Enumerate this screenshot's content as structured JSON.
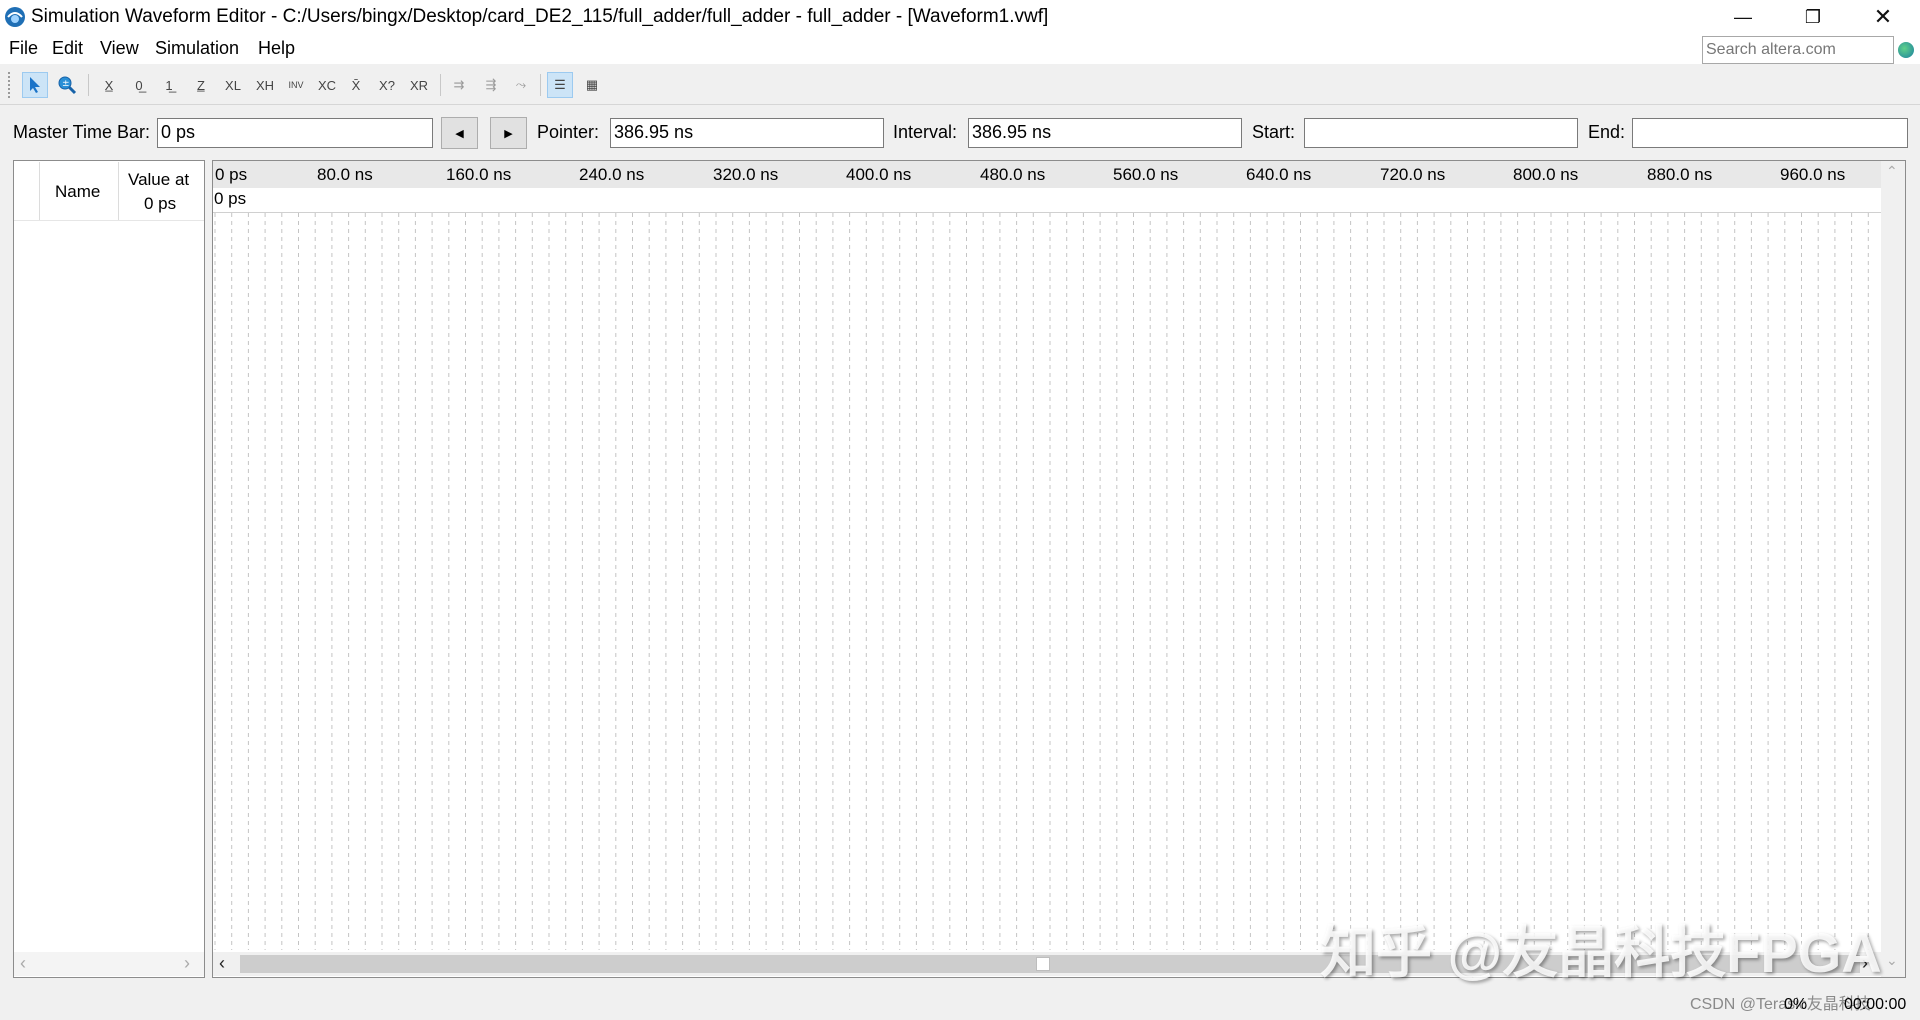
{
  "window": {
    "title": "Simulation Waveform Editor - C:/Users/bingx/Desktop/card_DE2_115/full_adder/full_adder - full_adder - [Waveform1.vwf]"
  },
  "menu": {
    "items": [
      {
        "label": "File"
      },
      {
        "label": "Edit"
      },
      {
        "label": "View"
      },
      {
        "label": "Simulation"
      },
      {
        "label": "Help"
      }
    ]
  },
  "search": {
    "placeholder": "Search altera.com"
  },
  "toolbar": {
    "icons": [
      "selection-tool-icon",
      "zoom-tool-icon",
      "forcing-unknown-icon",
      "forcing-low-icon",
      "forcing-high-icon",
      "high-impedance-icon",
      "weak-low-icon",
      "weak-high-icon",
      "invert-icon",
      "count-value-icon",
      "clock-value-icon",
      "arbitrary-value-icon",
      "random-value-icon",
      "snap-to-grid-icon",
      "grid-settings-icon",
      "transition-icon",
      "waveform-view-icon",
      "group-icon"
    ]
  },
  "timebar": {
    "master_label": "Master Time Bar:",
    "master_value": "0 ps",
    "pointer_label": "Pointer:",
    "pointer_value": "386.95 ns",
    "interval_label": "Interval:",
    "interval_value": "386.95 ns",
    "start_label": "Start:",
    "start_value": "",
    "end_label": "End:",
    "end_value": ""
  },
  "signals": {
    "name_header": "Name",
    "value_header_line1": "Value at",
    "value_header_line2": "0 ps"
  },
  "ruler": {
    "ticks": [
      "0 ps",
      "80.0 ns",
      "160.0 ns",
      "240.0 ns",
      "320.0 ns",
      "400.0 ns",
      "480.0 ns",
      "560.0 ns",
      "640.0 ns",
      "720.0 ns",
      "800.0 ns",
      "880.0 ns",
      "960.0 ns"
    ],
    "cursor_label": "0 ps"
  },
  "watermark": "知乎 @友晶科技FPGA",
  "status": {
    "credit": "CSDN @Terasic友晶科技",
    "progress": "0%",
    "elapsed": "00:00:00"
  }
}
